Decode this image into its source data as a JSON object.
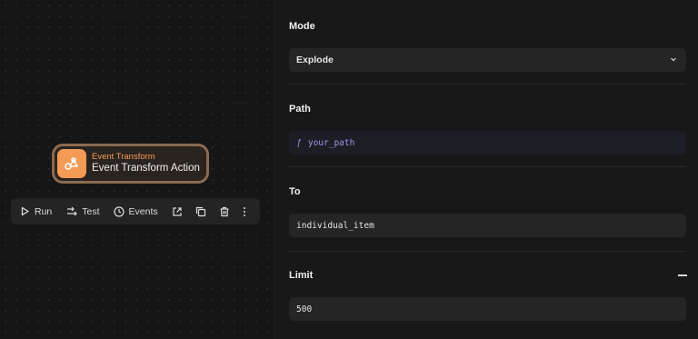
{
  "node": {
    "type_label": "Event Transform",
    "name": "Event Transform Action",
    "icon": "transform-icon",
    "accent_color": "#f39a55"
  },
  "toolbar": {
    "run_label": "Run",
    "test_label": "Test",
    "events_label": "Events"
  },
  "panel": {
    "mode": {
      "label": "Mode",
      "value": "Explode"
    },
    "path": {
      "label": "Path",
      "fx": "ƒ",
      "value": "your_path"
    },
    "to": {
      "label": "To",
      "value": "individual_item"
    },
    "limit": {
      "label": "Limit",
      "value": "500"
    }
  }
}
